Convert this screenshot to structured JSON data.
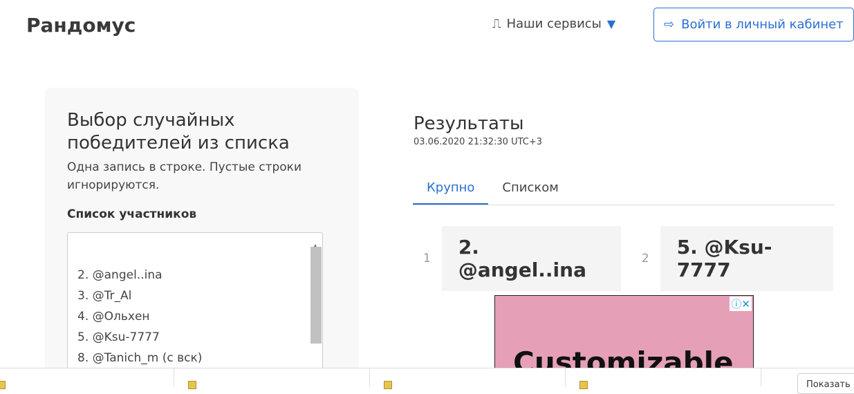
{
  "header": {
    "logo": "Рандомус",
    "services": "Наши сервисы",
    "login": "Войти в личный кабинет"
  },
  "form": {
    "title": "Выбор случайных победителей из списка",
    "hint": "Одна запись в строке. Пустые строки игнорируются.",
    "list_label": "Список участников",
    "lines": [
      "2. @angel..ina",
      "3. @Tr_Al",
      "4. @Ольхен",
      "5. @Ksu-7777",
      "8. @Tanich_m (с вск)"
    ]
  },
  "results": {
    "title": "Результаты",
    "timestamp": "03.06.2020 21:32:30 UTC+3",
    "tabs": [
      "Крупно",
      "Списком"
    ],
    "winners": [
      {
        "n": "1",
        "name": "2. @angel..ina"
      },
      {
        "n": "2",
        "name": "5. @Ksu-7777"
      }
    ]
  },
  "ad": {
    "text": "Customizable",
    "icons": "ⓘ✕"
  },
  "downloads": {
    "show_all": "Показать"
  }
}
